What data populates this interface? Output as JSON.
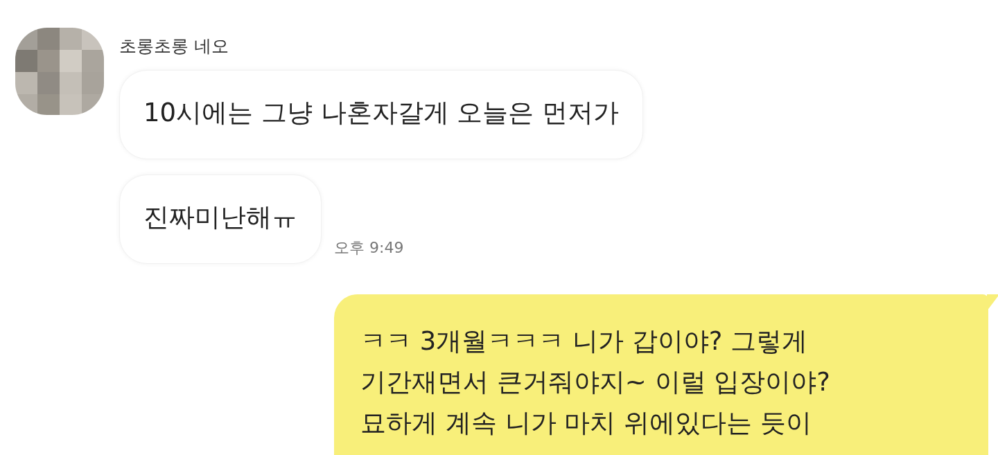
{
  "contact": {
    "name": "초롱초롱 네오"
  },
  "messages": [
    {
      "kind": "incoming",
      "lines": [
        "10시에는 그냥 나혼자갈게 오늘은 먼저가"
      ]
    },
    {
      "kind": "incoming",
      "lines": [
        "진짜미난해ㅠ"
      ],
      "time": "오후 9:49"
    },
    {
      "kind": "outgoing",
      "lines": [
        "ㅋㅋ 3개월ㅋㅋㅋ 니가 갑이야? 그렇게",
        "기간재면서 큰거줘야지~ 이럴 입장이야?",
        "묘하게 계속 니가 마치 위에있다는 듯이"
      ]
    }
  ]
}
